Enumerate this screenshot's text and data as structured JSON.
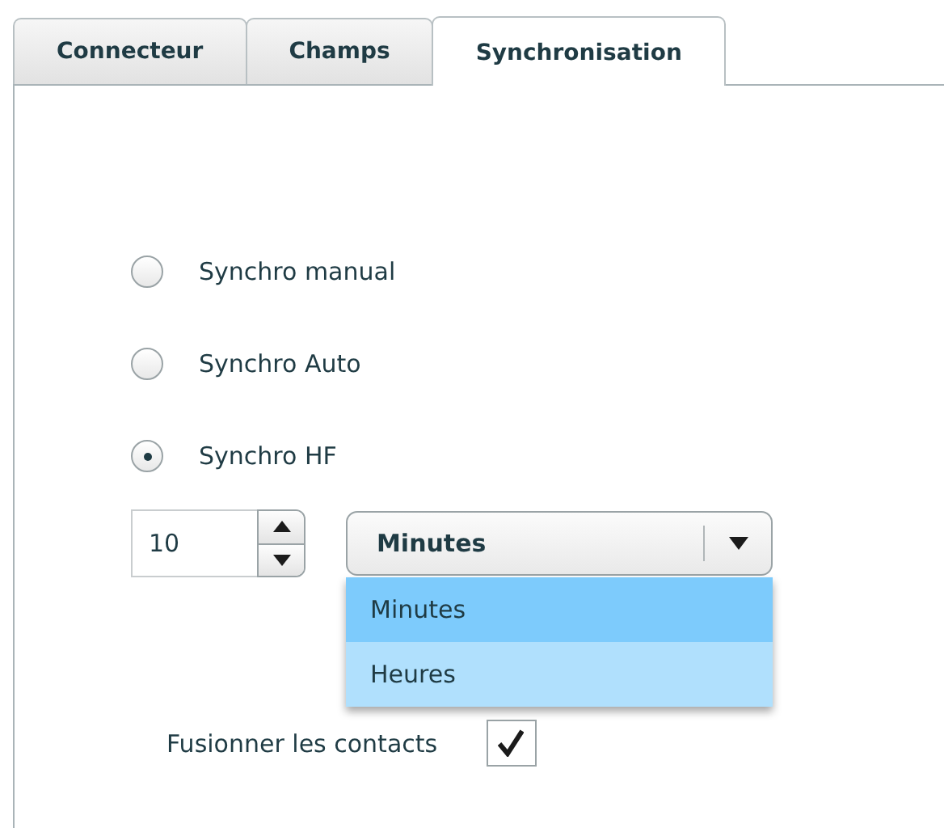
{
  "tabs": [
    {
      "label": "Connecteur",
      "selected": false
    },
    {
      "label": "Champs",
      "selected": false
    },
    {
      "label": "Synchronisation",
      "selected": true
    }
  ],
  "sync_modes": [
    {
      "label": "Synchro manual",
      "selected": false
    },
    {
      "label": "Synchro Auto",
      "selected": false
    },
    {
      "label": "Synchro HF",
      "selected": true
    }
  ],
  "interval": {
    "value": "10"
  },
  "unit_select": {
    "value": "Minutes",
    "expanded": true,
    "options": [
      {
        "label": "Minutes",
        "selected": true
      },
      {
        "label": "Heures",
        "selected": false
      }
    ]
  },
  "merge_contacts": {
    "label": "Fusionner les contacts",
    "checked": true
  }
}
